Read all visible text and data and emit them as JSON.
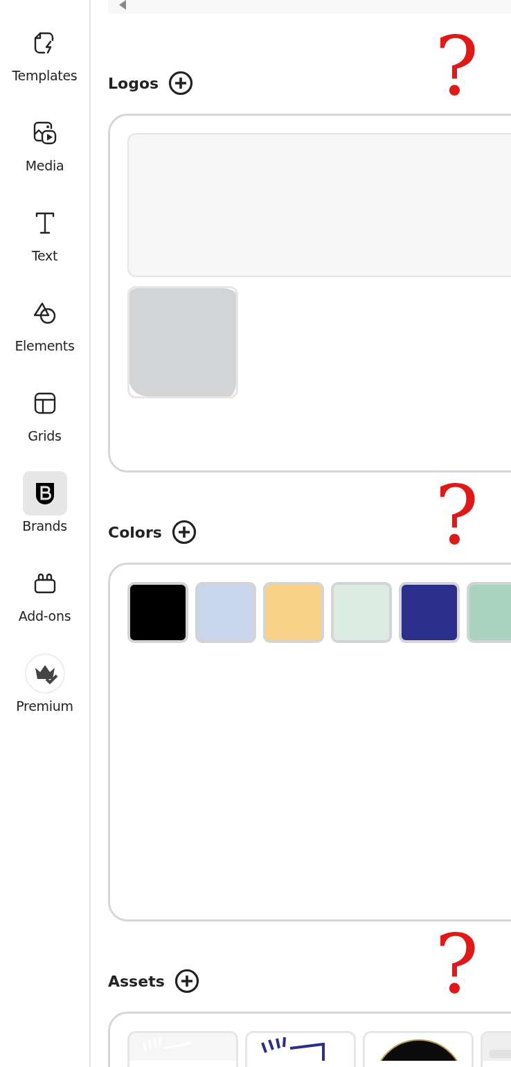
{
  "sidebar": {
    "items": [
      {
        "label": "Templates",
        "selected": false
      },
      {
        "label": "Media",
        "selected": false
      },
      {
        "label": "Text",
        "selected": false
      },
      {
        "label": "Elements",
        "selected": false
      },
      {
        "label": "Grids",
        "selected": false
      },
      {
        "label": "Brands",
        "selected": true
      },
      {
        "label": "Add-ons",
        "selected": false
      },
      {
        "label": "Premium",
        "selected": false
      }
    ]
  },
  "sections": [
    {
      "kind": "logos",
      "title": "Logos",
      "annotation": "?",
      "items": [
        {
          "redacted": true
        }
      ]
    },
    {
      "kind": "colors",
      "title": "Colors",
      "annotation": "?",
      "swatches": [
        {
          "color": "#000000"
        },
        {
          "color": "#c9d5ec"
        },
        {
          "color": "#f8d188"
        },
        {
          "color": "#dcebe3"
        },
        {
          "color": "#2b2f8b"
        },
        {
          "color": "#aad4bf"
        }
      ]
    },
    {
      "kind": "assets",
      "title": "Assets",
      "annotation": "?"
    }
  ]
}
